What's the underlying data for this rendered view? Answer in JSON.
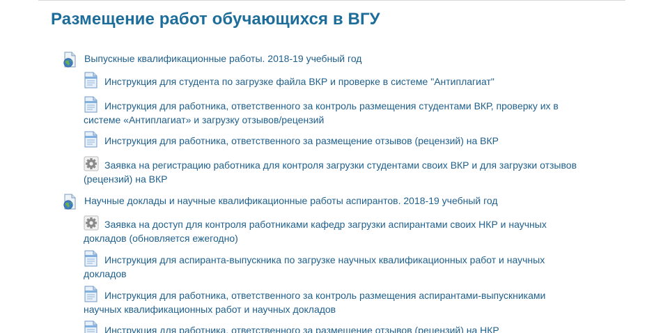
{
  "page": {
    "title": "Размещение работ обучающихся в ВГУ"
  },
  "sections": [
    {
      "label": "Выпускные квалификационные работы. 2018-19 учебный год",
      "icon": "globe-doc-icon",
      "items": [
        {
          "label": "Инструкция для студента по загрузке файла ВКР и проверке в системе \"Антиплагиат\"",
          "icon": "document-icon"
        },
        {
          "label": "Инструкция для работника, ответственного за контроль размещения студентами ВКР, проверку их в системе «Антиплагиат» и загрузку отзывов/рецензий",
          "icon": "document-icon"
        },
        {
          "label": "Инструкция для работника, ответственного за размещение отзывов (рецензий) на ВКР",
          "icon": "document-icon"
        },
        {
          "label": "Заявка на регистрацию работника для контроля загрузки студентами своих ВКР и для загрузки отзывов (рецензий) на ВКР",
          "icon": "gear-icon"
        }
      ]
    },
    {
      "label": "Научные доклады и научные квалификационные работы аспирантов. 2018-19 учебный год",
      "icon": "globe-doc-icon",
      "items": [
        {
          "label": "Заявка на доступ для контроля работниками кафедр загрузки аспирантами своих НКР и научных докладов (обновляется ежегодно)",
          "icon": "gear-icon"
        },
        {
          "label": "Инструкция для аспиранта-выпускника по загрузке научных квалификационных работ и научных докладов",
          "icon": "document-icon"
        },
        {
          "label": " Инструкция для работника, ответственного за контроль размещения аспирантами-выпускниками научных квалификационных работ и научных докладов",
          "icon": "document-icon"
        },
        {
          "label": "Инструкция для работника, ответственного за размещение отзывов (рецензий) на НКР",
          "icon": "document-icon"
        }
      ]
    }
  ]
}
